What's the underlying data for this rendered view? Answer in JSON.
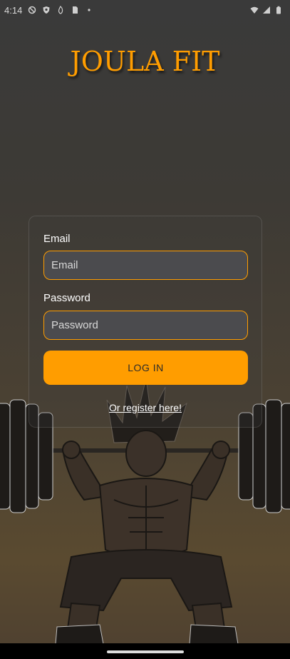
{
  "status_bar": {
    "time": "4:14",
    "icons_left": [
      "blocked-icon",
      "shield-icon",
      "fire-icon",
      "sim-icon",
      "dot-icon"
    ],
    "icons_right": [
      "wifi-icon",
      "signal-icon",
      "battery-icon"
    ]
  },
  "app": {
    "title": "JOULA FIT",
    "accent_color": "#ff9d00"
  },
  "login": {
    "email_label": "Email",
    "email_placeholder": "Email",
    "password_label": "Password",
    "password_placeholder": "Password",
    "login_button": "LOG IN",
    "register_link": "Or register here!"
  }
}
